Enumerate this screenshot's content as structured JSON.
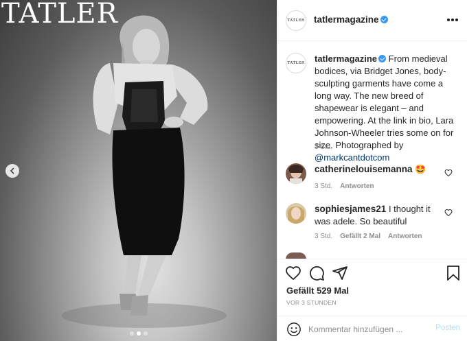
{
  "photo": {
    "wordmark": "TATLER",
    "carousel_total": 3,
    "carousel_active": 2
  },
  "header": {
    "avatar_text": "TATLER",
    "username": "tatlermagazine",
    "verified": true
  },
  "caption": {
    "username": "tatlermagazine",
    "text": "From medieval bodices, via Bridget Jones, body-sculpting garments have come a long way. The new breed of shapewear is elegant – and empowering. At the link in bio, Lara Johnson-Wheeler tries some on for size. Photographed by ",
    "mention": "@markcantdotcom",
    "time": "3 Std."
  },
  "comments": [
    {
      "username": "catherinelouisemanna",
      "text": "🤩",
      "time": "3 Std.",
      "likes": "",
      "reply": "Antworten"
    },
    {
      "username": "sophiesjames21",
      "text": "I thought it was adele. So beautiful",
      "time": "3 Std.",
      "likes": "Gefällt 2 Mal",
      "reply": "Antworten"
    }
  ],
  "actions": {
    "likes": "Gefällt 529 Mal",
    "timestamp": "VOR 3 STUNDEN"
  },
  "comment_bar": {
    "placeholder": "Kommentar hinzufügen ...",
    "post_label": "Posten"
  },
  "colors": {
    "link": "#00376b",
    "verified": "#3897f0",
    "post_disabled": "#b2dffc",
    "meta": "#8e8e8e"
  },
  "icons": [
    "chevron-left-icon",
    "more-icon",
    "heart-icon",
    "comment-icon",
    "share-icon",
    "bookmark-icon",
    "emoji-icon",
    "verified-badge-icon"
  ]
}
